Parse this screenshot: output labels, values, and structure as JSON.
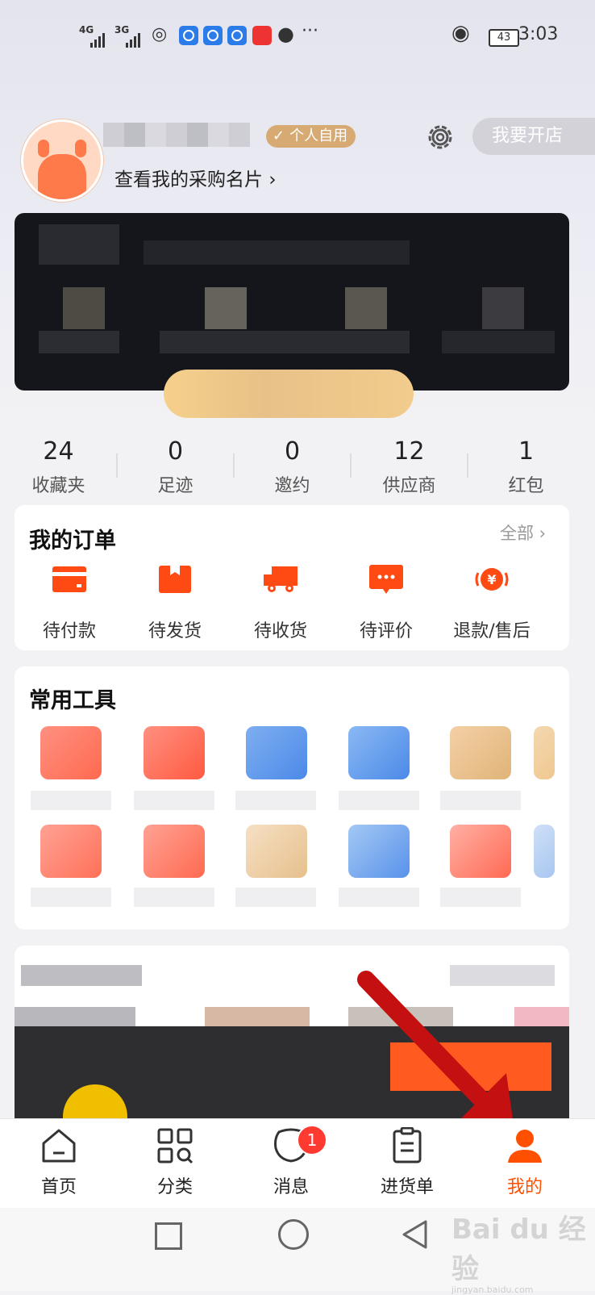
{
  "status_bar": {
    "net1": "4G",
    "net2": "3G",
    "battery": "43",
    "time": "3:03",
    "signal_icon": "signal-icon",
    "eye_icon": "eye-icon"
  },
  "profile": {
    "badge": "个人自用",
    "card_link": "查看我的采购名片",
    "open_store_button": "我要开店"
  },
  "stats": [
    {
      "value": "24",
      "label": "收藏夹"
    },
    {
      "value": "0",
      "label": "足迹"
    },
    {
      "value": "0",
      "label": "邀约"
    },
    {
      "value": "12",
      "label": "供应商"
    },
    {
      "value": "1",
      "label": "红包"
    }
  ],
  "orders": {
    "title": "我的订单",
    "all_link": "全部",
    "items": [
      {
        "label": "待付款",
        "icon": "card-icon"
      },
      {
        "label": "待发货",
        "icon": "box-icon"
      },
      {
        "label": "待收货",
        "icon": "truck-icon"
      },
      {
        "label": "待评价",
        "icon": "comment-icon"
      },
      {
        "label": "退款/售后",
        "icon": "refund-icon"
      }
    ]
  },
  "tools": {
    "title": "常用工具"
  },
  "tabbar": {
    "items": [
      {
        "label": "首页",
        "icon": "home-icon"
      },
      {
        "label": "分类",
        "icon": "category-icon"
      },
      {
        "label": "消息",
        "icon": "message-icon"
      },
      {
        "label": "进货单",
        "icon": "clipboard-icon"
      },
      {
        "label": "我的",
        "icon": "user-icon"
      }
    ],
    "message_badge": "1",
    "active_index": 4
  },
  "watermark": {
    "brand": "Bai du 经验",
    "url": "jingyan.baidu.com"
  },
  "colors": {
    "accent": "#ff5000",
    "badge": "#d8aa73",
    "banner": "#15161b",
    "arrow": "#c41010"
  }
}
